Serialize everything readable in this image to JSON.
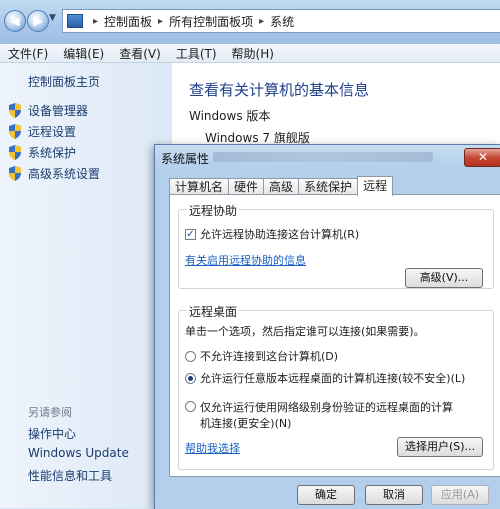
{
  "explorer": {
    "breadcrumb": [
      "控制面板",
      "所有控制面板项",
      "系统"
    ],
    "menu": [
      "文件(F)",
      "编辑(E)",
      "查看(V)",
      "工具(T)",
      "帮助(H)"
    ],
    "left_pane": {
      "home": "控制面板主页",
      "tasks": [
        "设备管理器",
        "远程设置",
        "系统保护",
        "高级系统设置"
      ],
      "see_also_title": "另请参阅",
      "see_also": [
        "操作中心",
        "Windows Update",
        "性能信息和工具"
      ]
    },
    "main": {
      "title": "查看有关计算机的基本信息",
      "section": "Windows 版本",
      "edition": "Windows 7 旗舰版"
    }
  },
  "dialog": {
    "title": "系统属性",
    "close": "✕",
    "tabs": [
      "计算机名",
      "硬件",
      "高级",
      "系统保护",
      "远程"
    ],
    "active_tab": "远程",
    "remote_assistance": {
      "group": "远程协助",
      "allow_label": "允许远程协助连接这台计算机(R)",
      "allow_checked": true,
      "link": "有关启用远程协助的信息",
      "advanced_button": "高级(V)..."
    },
    "remote_desktop": {
      "group": "远程桌面",
      "instruction": "单击一个选项，然后指定谁可以连接(如果需要)。",
      "options": [
        "不允许连接到这台计算机(D)",
        "允许运行任意版本远程桌面的计算机连接(较不安全)(L)",
        "仅允许运行使用网络级别身份验证的远程桌面的计算",
        "机连接(更安全)(N)"
      ],
      "selected_index": 1,
      "help_link": "帮助我选择",
      "select_users_button": "选择用户(S)..."
    },
    "buttons": {
      "ok": "确定",
      "cancel": "取消",
      "apply": "应用(A)"
    }
  }
}
